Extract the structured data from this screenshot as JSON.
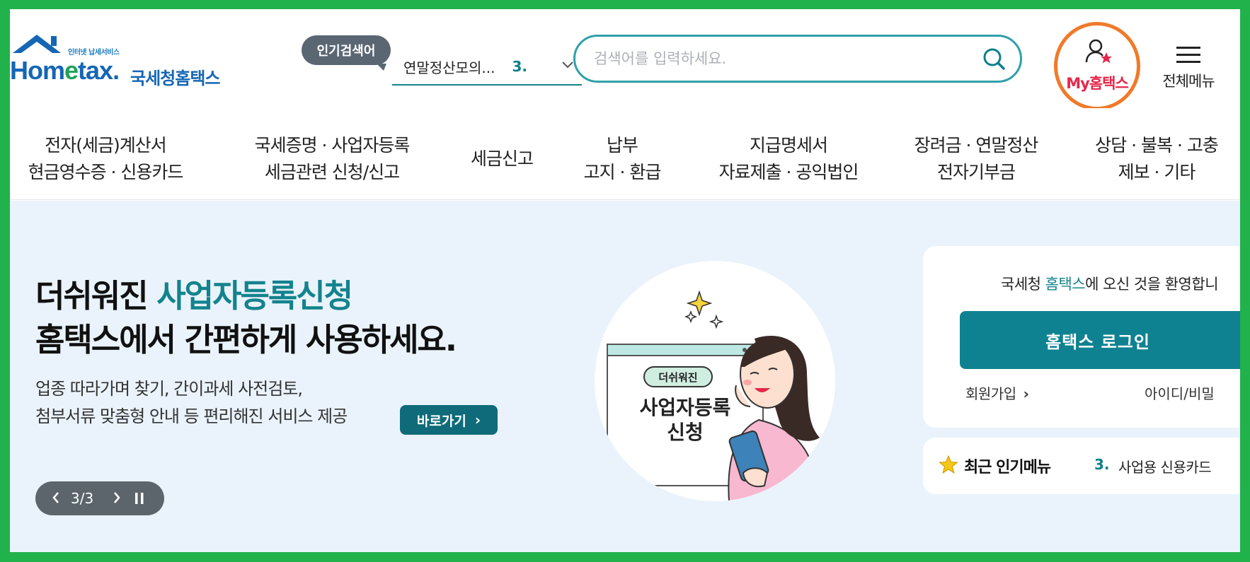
{
  "colors": {
    "accent": "#0f8291",
    "highlight": "#13838d",
    "brand": "#1566b4",
    "frame": "#22b24c",
    "my_hometax": "#e5274a",
    "annotation": "#f07a2a"
  },
  "header": {
    "logo_small": "인터넷 납세서비스",
    "logo_main_pre": "Hom",
    "logo_main_e": "e",
    "logo_main_post": "tax.",
    "logo_sub": "국세청홈택스",
    "popular_label": "인기검색어",
    "popular_term": "연말정산모의...",
    "popular_rank": "3.",
    "search_placeholder": "검색어를 입력하세요.",
    "my_hometax": "My홈택스",
    "full_menu": "전체메뉴",
    "icons": {
      "chevron": "chevron-down-icon",
      "search": "search-icon",
      "user": "user-star-icon",
      "menu": "hamburger-icon"
    }
  },
  "gnb": [
    {
      "line1": "전자(세금)계산서",
      "line2": "현금영수증 · 신용카드"
    },
    {
      "line1": "국세증명 · 사업자등록",
      "line2": "세금관련 신청/신고"
    },
    {
      "line1": "세금신고",
      "line2": ""
    },
    {
      "line1": "납부",
      "line2": "고지 · 환급"
    },
    {
      "line1": "지급명세서",
      "line2": "자료제출 · 공익법인"
    },
    {
      "line1": "장려금 · 연말정산",
      "line2": "전자기부금"
    },
    {
      "line1": "상담 · 불복 · 고충",
      "line2": "제보 · 기타"
    }
  ],
  "hero": {
    "title_pre": "더쉬워진 ",
    "title_highlight": "사업자등록신청",
    "title_line2": "홈택스에서 간편하게 사용하세요.",
    "desc_line1": "업종 따라가며 찾기, 간이과세 사전검토,",
    "desc_line2": "첨부서류 맞춤형 안내 등 편리해진 서비스 제공",
    "go_button": "바로가기",
    "pager_count": "3/3",
    "illustration_badge": "더쉬워진",
    "illustration_title1": "사업자등록",
    "illustration_title2": "신청"
  },
  "login": {
    "welcome_pre": "국세청 ",
    "welcome_highlight": "홈택스",
    "welcome_post": "에 오신 것을 환영합니",
    "login_button": "홈택스 로그인",
    "join": "회원가입",
    "find": "아이디/비밀"
  },
  "recent": {
    "title": "최근 인기메뉴",
    "rank": "3.",
    "item": "사업용 신용카드"
  }
}
